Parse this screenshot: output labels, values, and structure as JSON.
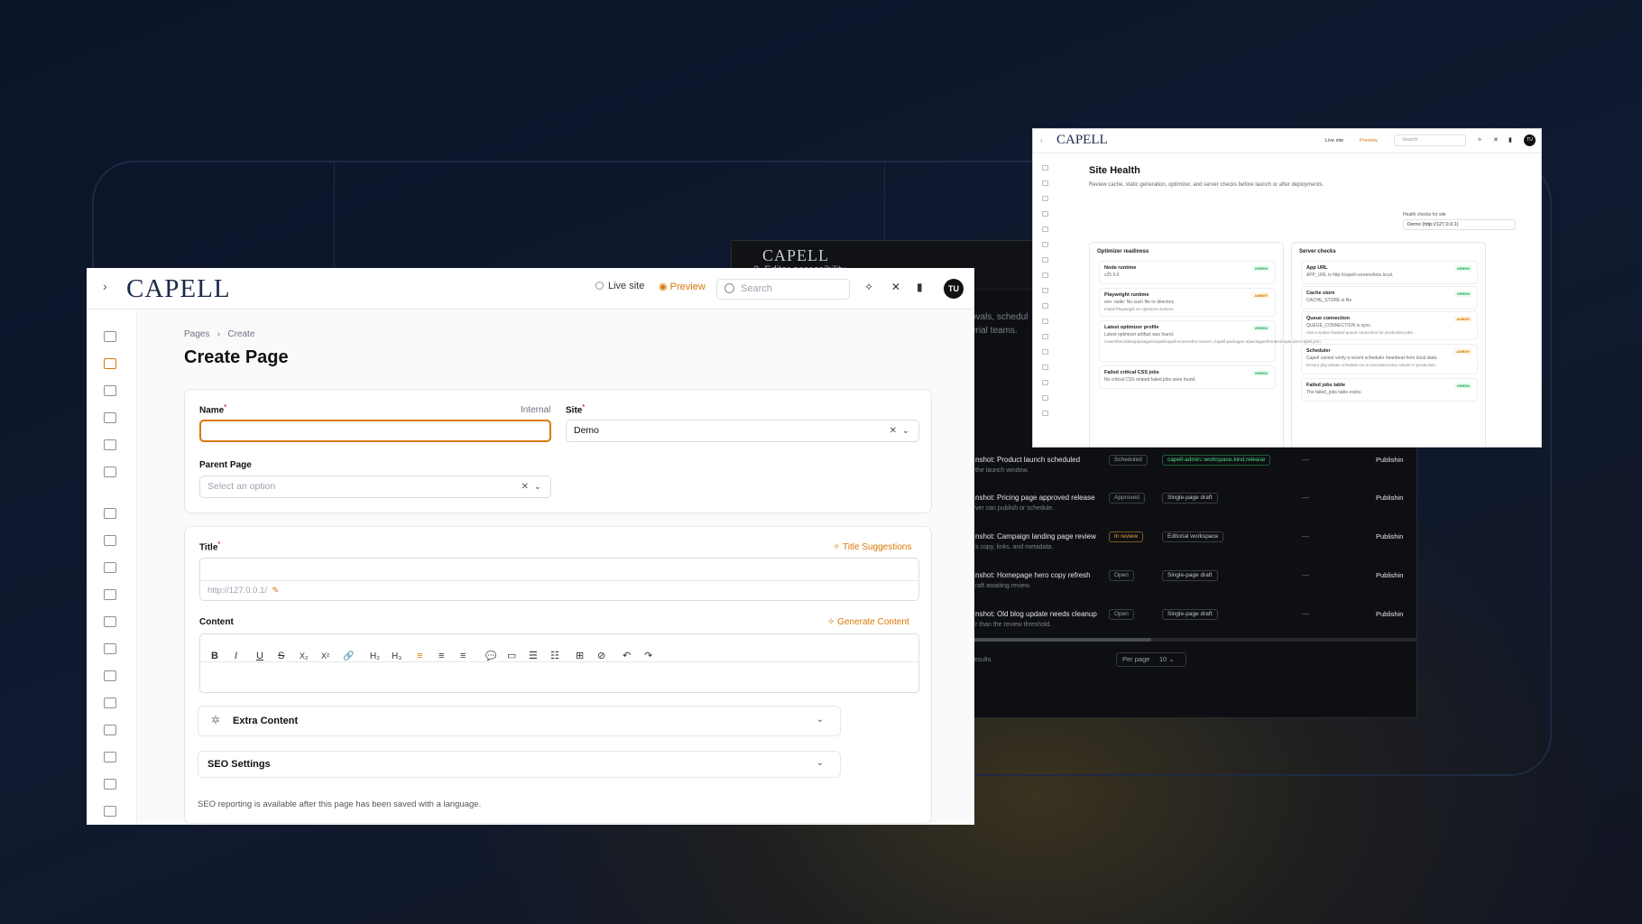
{
  "background_window": {
    "brand": "CAPELL",
    "subtitle": "2. Editor accessibility",
    "fragments": [
      "ovals, schedul",
      "erial teams."
    ],
    "rows": [
      {
        "title": "nshot: Product launch scheduled",
        "sub": "the launch window.",
        "status": "Scheduled",
        "tag": "capell-admin::workspace.kind.release",
        "dash": "—",
        "action": "Publishin"
      },
      {
        "title": "nshot: Pricing page approved release",
        "sub": "ver can publish or schedule.",
        "status": "Approved",
        "tag": "Single-page draft",
        "dash": "—",
        "action": "Publishin"
      },
      {
        "title": "nshot: Campaign landing page review",
        "sub": "s copy, links, and metadata.",
        "status": "In review",
        "tag": "Editorial workspace",
        "dash": "—",
        "action": "Publishin"
      },
      {
        "title": "nshot: Homepage hero copy refresh",
        "sub": "raft awaiting review.",
        "status": "Open",
        "tag": "Single-page draft",
        "dash": "—",
        "action": "Publishin"
      },
      {
        "title": "nshot: Old blog update needs cleanup",
        "sub": "r than the review threshold.",
        "status": "Open",
        "tag": "Single-page draft",
        "dash": "—",
        "action": "Publishin"
      }
    ],
    "results": "esults",
    "per_page_label": "Per page",
    "per_page_value": "10"
  },
  "site_health": {
    "logo": "CAPELL",
    "live": "Live site",
    "preview": "Preview",
    "search": "Search",
    "avatar": "TU",
    "title": "Site Health",
    "description": "Review cache, static generation, optimizer, and server checks before launch or after deployments.",
    "health_label": "Health checks for site",
    "health_value": "Demo (http://127.0.0.1)",
    "panels": [
      {
        "title": "Optimizer readiness",
        "cards": [
          {
            "title": "Node runtime",
            "desc": "v25.9.0",
            "extra": "",
            "status": "GREEN",
            "kind": "g"
          },
          {
            "title": "Playwright runtime",
            "desc": "env: node: No such file or directory",
            "extra": "Install Playwright on optimizer workers.",
            "status": "AMBER",
            "kind": "a"
          },
          {
            "title": "Latest optimizer profile",
            "desc": "Latest optimizer artifact was found.",
            "extra": "/Users/ben/Sites/packages/capell/capell-screenshot-runner/../capell-packages-4/packages/frontend-optimizer/capell.json",
            "status": "GREEN",
            "kind": "g"
          },
          {
            "title": "Failed critical CSS jobs",
            "desc": "No critical CSS related failed jobs were found.",
            "extra": "",
            "status": "GREEN",
            "kind": "g"
          }
        ]
      },
      {
        "title": "Server checks",
        "cards": [
          {
            "title": "App URL",
            "desc": "APP_URL is http://capell-screenshots.local.",
            "extra": "",
            "status": "GREEN",
            "kind": "g"
          },
          {
            "title": "Cache store",
            "desc": "CACHE_STORE is file.",
            "extra": "",
            "status": "GREEN",
            "kind": "g"
          },
          {
            "title": "Queue connection",
            "desc": "QUEUE_CONNECTION is sync.",
            "extra": "Use a worker-backed queue connection for production jobs.",
            "status": "AMBER",
            "kind": "a"
          },
          {
            "title": "Scheduler",
            "desc": "Capell cannot verify a recent scheduler heartbeat from local state.",
            "extra": "Ensure php artisan schedule:run is executed every minute in production.",
            "status": "AMBER",
            "kind": "a"
          },
          {
            "title": "Failed jobs table",
            "desc": "The failed_jobs table exists.",
            "extra": "",
            "status": "GREEN",
            "kind": "g"
          }
        ]
      }
    ]
  },
  "create_page": {
    "logo": "CAPELL",
    "live": "Live site",
    "preview": "Preview",
    "search_placeholder": "Search",
    "avatar": "TU",
    "breadcrumb": [
      "Pages",
      "Create"
    ],
    "title": "Create Page",
    "form": {
      "name_label": "Name",
      "name_hint": "Internal",
      "name_value": "",
      "site_label": "Site",
      "site_value": "Demo",
      "parent_label": "Parent Page",
      "parent_placeholder": "Select an option",
      "title_label": "Title",
      "title_suggestions": "Title Suggestions",
      "url_prefix": "http://127.0.0.1/",
      "content_label": "Content",
      "generate_content": "Generate Content",
      "toolbar": [
        "B",
        "I",
        "U",
        "S",
        "X₂",
        "X²",
        "🔗",
        "H₂",
        "H₃",
        "≡",
        "≡",
        "≡",
        "💬",
        "▭",
        "☰",
        "☷",
        "⊞",
        "⊘",
        "↶",
        "↷"
      ]
    },
    "extra_content": "Extra Content",
    "seo_settings": "SEO Settings",
    "seo_note": "SEO reporting is available after this page has been saved with a language."
  }
}
